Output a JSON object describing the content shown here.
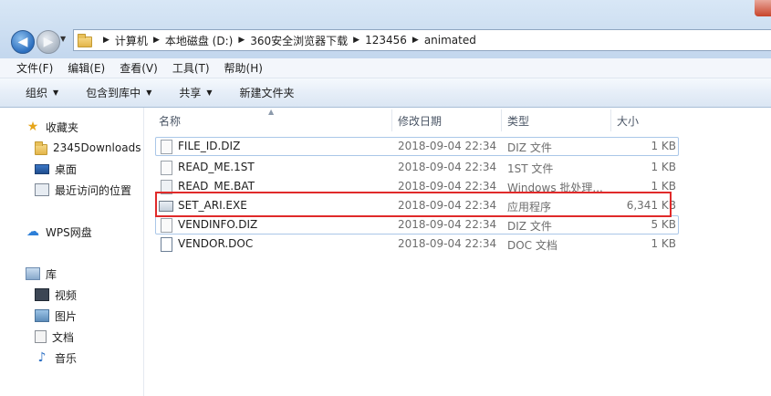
{
  "address": {
    "crumbs": [
      "计算机",
      "本地磁盘 (D:)",
      "360安全浏览器下载",
      "123456",
      "animated"
    ]
  },
  "menu": [
    "文件(F)",
    "编辑(E)",
    "查看(V)",
    "工具(T)",
    "帮助(H)"
  ],
  "toolbar": {
    "organize": "组织",
    "include_in_library": "包含到库中",
    "share": "共享",
    "new_folder": "新建文件夹"
  },
  "nav": {
    "favorites": "收藏夹",
    "downloads": "2345Downloads",
    "desktop": "桌面",
    "recent": "最近访问的位置",
    "wps": "WPS网盘",
    "library": "库",
    "videos": "视频",
    "pictures": "图片",
    "documents": "文档",
    "music": "音乐"
  },
  "columns": {
    "name": "名称",
    "modified": "修改日期",
    "type": "类型",
    "size": "大小"
  },
  "files": [
    {
      "name": "FILE_ID.DIZ",
      "modified": "2018-09-04 22:34",
      "type": "DIZ 文件",
      "size": "1 KB"
    },
    {
      "name": "READ_ME.1ST",
      "modified": "2018-09-04 22:34",
      "type": "1ST 文件",
      "size": "1 KB"
    },
    {
      "name": "READ_ME.BAT",
      "modified": "2018-09-04 22:34",
      "type": "Windows 批处理...",
      "size": "1 KB"
    },
    {
      "name": "SET_ARI.EXE",
      "modified": "2018-09-04 22:34",
      "type": "应用程序",
      "size": "6,341 KB"
    },
    {
      "name": "VENDINFO.DIZ",
      "modified": "2018-09-04 22:34",
      "type": "DIZ 文件",
      "size": "5 KB"
    },
    {
      "name": "VENDOR.DOC",
      "modified": "2018-09-04 22:34",
      "type": "DOC 文档",
      "size": "1 KB"
    }
  ],
  "colors": {
    "highlight": "#e02a2a",
    "selection_border": "#aac7e8"
  }
}
